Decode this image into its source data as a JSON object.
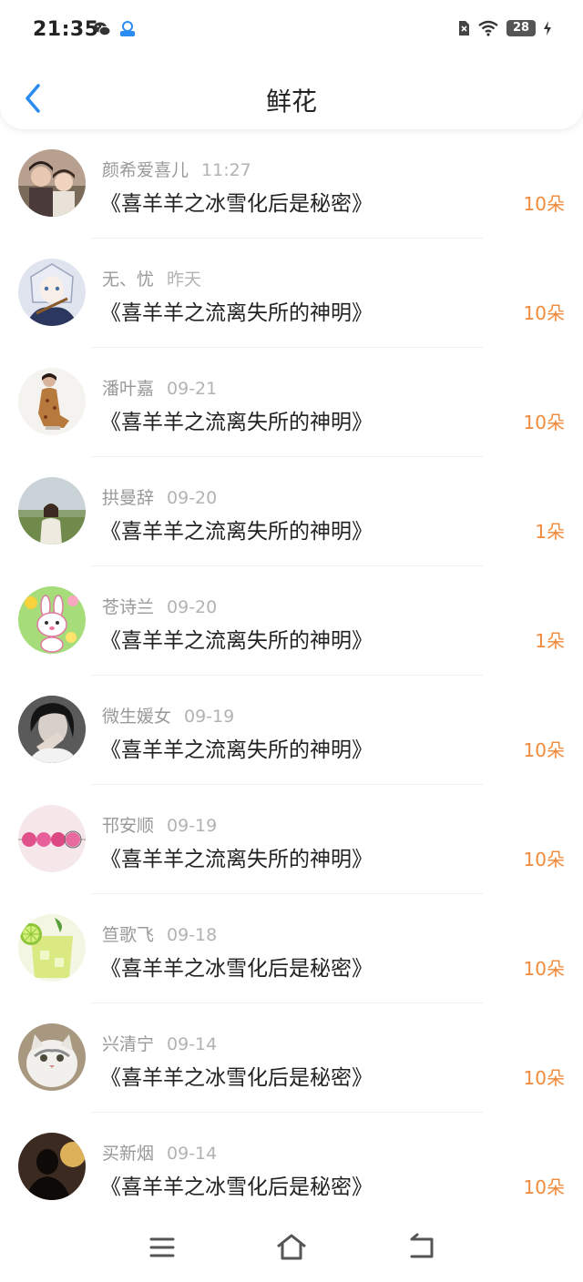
{
  "status_bar": {
    "time": "21:35",
    "battery": "28"
  },
  "header": {
    "title": "鲜花"
  },
  "colors": {
    "accent_orange": "#f28a3c",
    "back_blue": "#2a8cf0"
  },
  "items": [
    {
      "name": "颜希爱喜儿",
      "time": "11:27",
      "title": "《喜羊羊之冰雪化后是秘密》",
      "count": "10朵",
      "avatar": "couple-photo"
    },
    {
      "name": "无、忧",
      "time": "昨天",
      "title": "《喜羊羊之流离失所的神明》",
      "count": "10朵",
      "avatar": "anime-character"
    },
    {
      "name": "潘叶嘉",
      "time": "09-21",
      "title": "《喜羊羊之流离失所的神明》",
      "count": "10朵",
      "avatar": "woman-in-dress"
    },
    {
      "name": "拱曼辞",
      "time": "09-20",
      "title": "《喜羊羊之流离失所的神明》",
      "count": "1朵",
      "avatar": "woman-in-field"
    },
    {
      "name": "苍诗兰",
      "time": "09-20",
      "title": "《喜羊羊之流离失所的神明》",
      "count": "1朵",
      "avatar": "cartoon-bunny"
    },
    {
      "name": "微生媛女",
      "time": "09-19",
      "title": "《喜羊羊之流离失所的神明》",
      "count": "10朵",
      "avatar": "woman-portrait"
    },
    {
      "name": "邗安顺",
      "time": "09-19",
      "title": "《喜羊羊之流离失所的神明》",
      "count": "10朵",
      "avatar": "pink-flowers"
    },
    {
      "name": "笪歌飞",
      "time": "09-18",
      "title": "《喜羊羊之冰雪化后是秘密》",
      "count": "10朵",
      "avatar": "lime-drink"
    },
    {
      "name": "兴清宁",
      "time": "09-14",
      "title": "《喜羊羊之冰雪化后是秘密》",
      "count": "10朵",
      "avatar": "fluffy-cat"
    },
    {
      "name": "买新烟",
      "time": "09-14",
      "title": "《喜羊羊之冰雪化后是秘密》",
      "count": "10朵",
      "avatar": "silhouette-sunset"
    }
  ],
  "bottom_nav": [
    "menu-icon",
    "home-icon",
    "back-icon"
  ]
}
